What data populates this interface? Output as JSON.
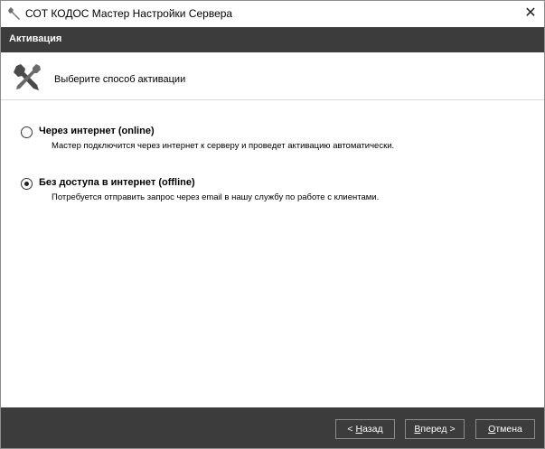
{
  "window": {
    "title": "СОТ КОДОС Мастер Настройки Сервера",
    "close_glyph": "✕",
    "app_icon": "wrench-icon"
  },
  "header": {
    "title": "Активация"
  },
  "subheader": {
    "text": "Выберите способ активации",
    "icon": "tools-icon"
  },
  "options": [
    {
      "label": "Через интернет (online)",
      "description": "Мастер подключится через интернет к серверу и проведет активацию автоматически.",
      "selected": false
    },
    {
      "label": "Без доступа в интернет (offline)",
      "description": "Потребуется отправить запрос через email в нашу службу по работе с клиентами.",
      "selected": true
    }
  ],
  "footer": {
    "back": {
      "prefix": "< ",
      "accel": "Н",
      "rest": "азад"
    },
    "next": {
      "prefix": "",
      "accel": "В",
      "rest": "перед >"
    },
    "cancel": {
      "prefix": "",
      "accel": "О",
      "rest": "тмена"
    }
  },
  "colors": {
    "header_bg": "#3c3c3c",
    "footer_bg": "#3c3c3c",
    "text_on_dark": "#ffffff"
  }
}
